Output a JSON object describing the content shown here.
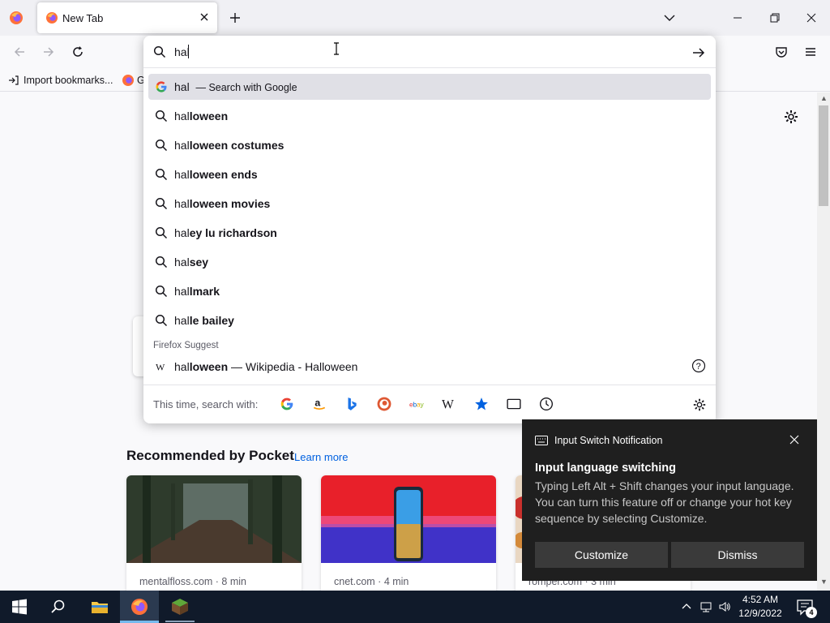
{
  "tabs": [
    {
      "title": "New Tab"
    }
  ],
  "bookmarks": {
    "import_label": "Import bookmarks...",
    "partial_label": "G"
  },
  "urlbar": {
    "input_value": "hal",
    "suggestions": [
      {
        "prefix": "hal",
        "completion": "",
        "action": "— Search with Google",
        "icon": "google-icon",
        "selected": true
      },
      {
        "prefix": "hal",
        "completion": "loween",
        "icon": "search-icon"
      },
      {
        "prefix": "hal",
        "completion": "loween costumes",
        "icon": "search-icon"
      },
      {
        "prefix": "hal",
        "completion": "loween ends",
        "icon": "search-icon"
      },
      {
        "prefix": "hal",
        "completion": "loween movies",
        "icon": "search-icon"
      },
      {
        "prefix": "hal",
        "completion": "ey lu richardson",
        "icon": "search-icon"
      },
      {
        "prefix": "hal",
        "completion": "sey",
        "icon": "search-icon"
      },
      {
        "prefix": "hal",
        "completion": "lmark",
        "icon": "search-icon"
      },
      {
        "prefix": "hal",
        "completion": "le bailey",
        "icon": "search-icon"
      }
    ],
    "firefox_suggest": {
      "label": "Firefox Suggest",
      "item": {
        "prefix": "hal",
        "completion": "loween",
        "rest": " — Wikipedia - Halloween",
        "icon": "wikipedia-icon"
      }
    },
    "oneoff": {
      "label": "This time, search with:",
      "engines": [
        "google-icon",
        "amazon-icon",
        "bing-icon",
        "duckduckgo-icon",
        "ebay-icon",
        "wikipedia-icon",
        "bookmarks-star-icon",
        "tabs-icon",
        "history-icon"
      ]
    }
  },
  "pocket": {
    "heading": "Recommended by Pocket",
    "learn_more": "Learn more",
    "stories": [
      {
        "source": "mentalfloss.com · 8 min"
      },
      {
        "source": "cnet.com · 4 min"
      },
      {
        "source": "romper.com · 3 min"
      }
    ]
  },
  "notification": {
    "app_name": "Input Switch Notification",
    "title": "Input language switching",
    "body": "Typing Left Alt + Shift changes your input language. You can turn this feature off or change your hot key sequence by selecting Customize.",
    "customize_label": "Customize",
    "dismiss_label": "Dismiss"
  },
  "taskbar": {
    "clock_time": "4:52 AM",
    "clock_date": "12/9/2022",
    "notification_count": "4"
  },
  "colors": {
    "accent_blue": "#0061e0",
    "toast_bg": "#1f1f1f",
    "taskbar_bg": "#101a2a",
    "selected_row": "#e0e0e6"
  }
}
